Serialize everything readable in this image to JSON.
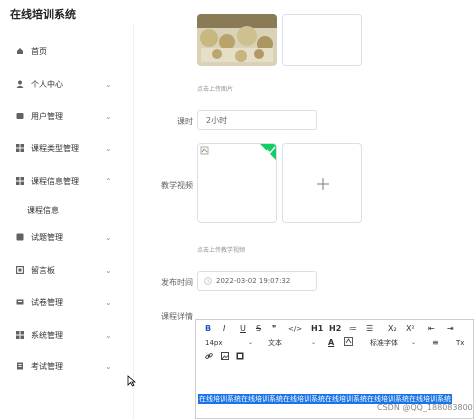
{
  "app": {
    "title": "在线培训系统"
  },
  "sidebar": {
    "items": [
      {
        "label": "首页",
        "icon": "home-icon",
        "arrow": false
      },
      {
        "label": "个人中心",
        "icon": "user-icon",
        "arrow": true
      },
      {
        "label": "用户管理",
        "icon": "users-icon",
        "arrow": true
      },
      {
        "label": "课程类型管理",
        "icon": "grid-icon",
        "arrow": true
      },
      {
        "label": "课程信息管理",
        "icon": "book-icon",
        "arrow": true,
        "expanded": true
      },
      {
        "label": "试题管理",
        "icon": "grid-icon",
        "arrow": true
      },
      {
        "label": "留言板",
        "icon": "message-icon",
        "arrow": true
      },
      {
        "label": "试卷管理",
        "icon": "paper-icon",
        "arrow": true
      },
      {
        "label": "系统管理",
        "icon": "grid-icon",
        "arrow": true
      },
      {
        "label": "考试管理",
        "icon": "exam-icon",
        "arrow": true
      }
    ],
    "submenu": [
      {
        "label": "课程信息"
      }
    ]
  },
  "form": {
    "image_hint": "点击上传图片",
    "hours_label": "课时",
    "hours_value": "2小时",
    "video_label": "教学视频",
    "video_hint": "点击上传教学视频",
    "publish_label": "发布时间",
    "publish_value": "2022-03-02 19:07:32",
    "details_label": "课程详情"
  },
  "editor": {
    "row1": [
      "B",
      "I",
      "U",
      "S",
      "❞",
      "</>",
      "H1",
      "H2",
      "≔",
      "☰",
      "X₂",
      "X²",
      "⇤",
      "⇥"
    ],
    "font_size": "14px",
    "text_type": "文本",
    "font_family": "标准字体",
    "content": "在线培训系统在线培训系统在线培训系统在线培训系统在线培训系统在线培训系统"
  },
  "watermark": "CSDN @QQ_188083800"
}
